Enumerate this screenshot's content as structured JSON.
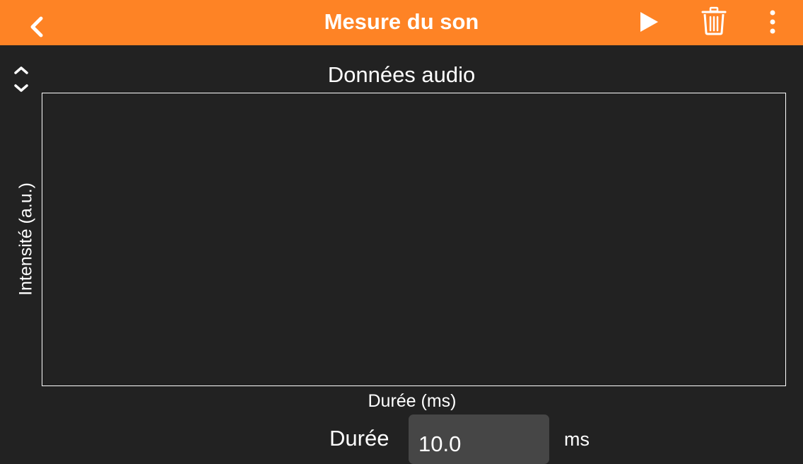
{
  "header": {
    "title": "Mesure du son",
    "background_color": "#fe8325",
    "icons": {
      "back": "chevron-left-icon",
      "play": "play-icon",
      "delete": "trash-icon",
      "more": "more-vertical-icon"
    }
  },
  "chart": {
    "collapse_icon": "chevron-up-down-icon"
  },
  "chart_data": {
    "type": "line",
    "title": "Données audio",
    "xlabel": "Durée (ms)",
    "ylabel": "Intensité (a.u.)",
    "series": [],
    "grid": false
  },
  "controls": {
    "duration_label": "Durée",
    "duration_value": "10.0",
    "duration_unit": "ms"
  },
  "colors": {
    "accent": "#fe8325",
    "background": "#222222",
    "input_background": "#464646"
  }
}
